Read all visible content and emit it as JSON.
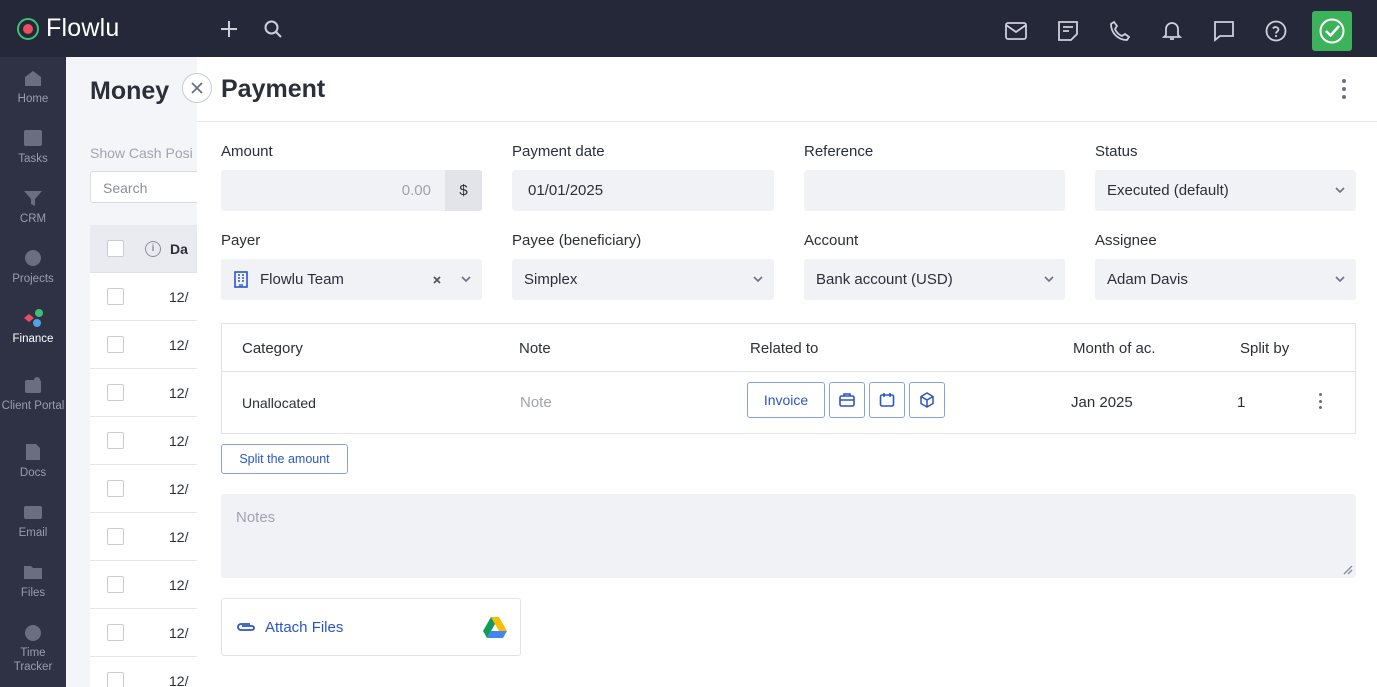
{
  "app": {
    "name": "Flowlu"
  },
  "sidebar": {
    "items": [
      {
        "label": "Home"
      },
      {
        "label": "Tasks"
      },
      {
        "label": "CRM"
      },
      {
        "label": "Projects"
      },
      {
        "label": "Finance"
      },
      {
        "label": "Client Portal"
      },
      {
        "label": "Docs"
      },
      {
        "label": "Email"
      },
      {
        "label": "Files"
      },
      {
        "label": "Time Tracker"
      }
    ],
    "active": "Finance"
  },
  "money": {
    "title": "Money",
    "show_cash": "Show Cash Posi",
    "search_placeholder": "Search",
    "date_header": "Da",
    "rows": [
      "12/",
      "12/",
      "12/",
      "12/",
      "12/",
      "12/",
      "12/",
      "12/",
      "12/"
    ]
  },
  "payment": {
    "title": "Payment",
    "amount": {
      "label": "Amount",
      "placeholder": "0.00",
      "currency": "$"
    },
    "payment_date": {
      "label": "Payment date",
      "value": "01/01/2025"
    },
    "reference": {
      "label": "Reference",
      "value": ""
    },
    "status": {
      "label": "Status",
      "value": "Executed (default)"
    },
    "payer": {
      "label": "Payer",
      "value": "Flowlu Team"
    },
    "payee": {
      "label": "Payee (beneficiary)",
      "value": "Simplex"
    },
    "account": {
      "label": "Account",
      "value": "Bank account (USD)"
    },
    "assignee": {
      "label": "Assignee",
      "value": "Adam Davis"
    },
    "table": {
      "headers": {
        "category": "Category",
        "note": "Note",
        "related": "Related to",
        "month": "Month of ac.",
        "split": "Split by"
      },
      "row": {
        "category": "Unallocated",
        "note_placeholder": "Note",
        "invoice_label": "Invoice",
        "month": "Jan 2025",
        "split": "1"
      }
    },
    "split_amount_label": "Split the amount",
    "notes_placeholder": "Notes",
    "attach_label": "Attach Files"
  },
  "colors": {
    "topbar": "#252838",
    "sidebar": "#2f3244",
    "accent": "#2a55c9",
    "success": "#3cb25a"
  }
}
